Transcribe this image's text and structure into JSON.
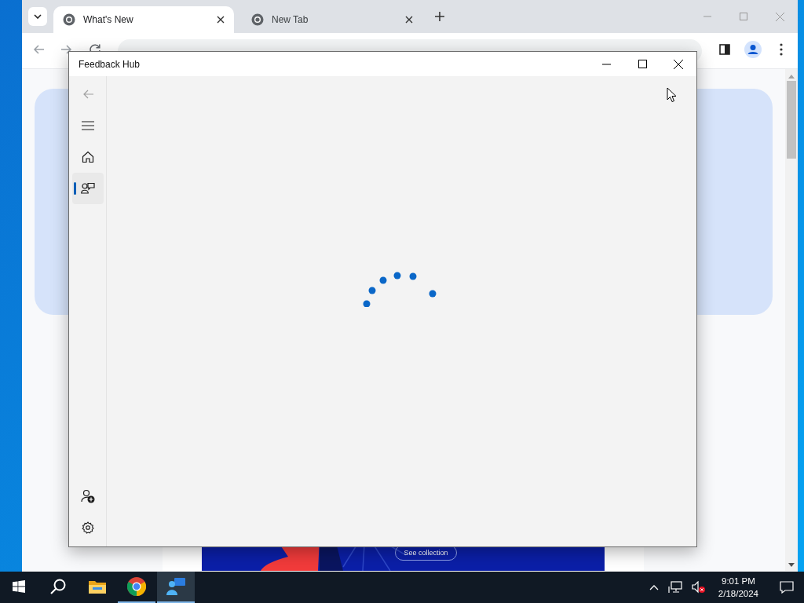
{
  "browser": {
    "tabs": [
      {
        "label": "What's New",
        "selected": true
      },
      {
        "label": "New Tab",
        "selected": false
      }
    ]
  },
  "page": {
    "banner_button": "See collection"
  },
  "feedback_hub": {
    "title": "Feedback Hub",
    "nav_items": [
      {
        "kind": "back",
        "selected": false,
        "disabled": true
      },
      {
        "kind": "menu",
        "selected": false,
        "disabled": false
      },
      {
        "kind": "home",
        "selected": false,
        "disabled": false
      },
      {
        "kind": "feedback",
        "selected": true,
        "disabled": false
      }
    ],
    "footer_items": [
      {
        "kind": "add-account"
      },
      {
        "kind": "settings"
      }
    ]
  },
  "taskbar": {
    "apps": [
      {
        "kind": "explorer",
        "running": false,
        "selected": false
      },
      {
        "kind": "chrome",
        "running": true,
        "selected": false
      },
      {
        "kind": "feedback",
        "running": true,
        "selected": true
      }
    ],
    "time": "9:01 PM",
    "date": "2/18/2024"
  }
}
